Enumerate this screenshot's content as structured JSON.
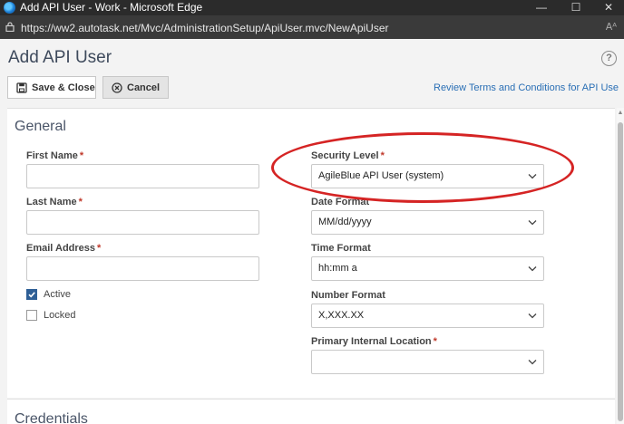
{
  "window": {
    "title": "Add API User - Work - Microsoft Edge",
    "minimize": "—",
    "maximize": "☐",
    "close": "✕"
  },
  "browser": {
    "url": "https://ww2.autotask.net/Mvc/AdministrationSetup/ApiUser.mvc/NewApiUser",
    "reader_icon": "Aᴬ"
  },
  "page": {
    "title": "Add API User",
    "help": "?"
  },
  "toolbar": {
    "save_close_label": "Save & Close",
    "cancel_label": "Cancel",
    "review_link": "Review Terms and Conditions for API Use"
  },
  "general": {
    "title": "General",
    "first_name_label": "First Name",
    "last_name_label": "Last Name",
    "email_label": "Email Address",
    "required_mark": "*",
    "active_label": "Active",
    "active_checked": true,
    "locked_label": "Locked",
    "locked_checked": false,
    "security_level_label": "Security Level",
    "security_level_value": "AgileBlue API User (system)",
    "date_format_label": "Date Format",
    "date_format_value": "MM/dd/yyyy",
    "time_format_label": "Time Format",
    "time_format_value": "hh:mm a",
    "number_format_label": "Number Format",
    "number_format_value": "X,XXX.XX",
    "primary_location_label": "Primary Internal Location",
    "primary_location_value": ""
  },
  "credentials": {
    "title": "Credentials"
  },
  "colors": {
    "accent": "#2e5f96",
    "link": "#2a6fb5",
    "required": "#c0392b",
    "annotation_ring": "#d52424"
  }
}
